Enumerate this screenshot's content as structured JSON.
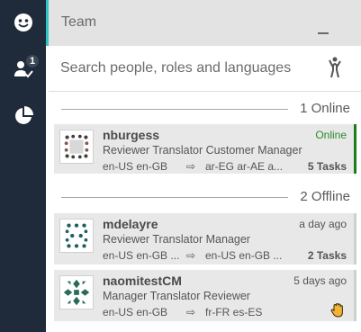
{
  "sidebar": {
    "items": [
      {
        "icon": "face-icon",
        "active": true
      },
      {
        "icon": "person-check-icon",
        "badge": "1"
      },
      {
        "icon": "pie-chart-icon"
      }
    ]
  },
  "header": {
    "title": "Team"
  },
  "search": {
    "placeholder": "Search people, roles and languages"
  },
  "sections": {
    "online": {
      "label": "1 Online"
    },
    "offline": {
      "label": "2 Offline"
    }
  },
  "users": [
    {
      "name": "nburgess",
      "status": "Online",
      "roles": "Reviewer Translator Customer Manager",
      "source_langs": "en-US en-GB",
      "target_langs": "ar-EG ar-AE a...",
      "tasks": "5 Tasks"
    },
    {
      "name": "mdelayre",
      "status": "a day ago",
      "roles": "Reviewer Translator Manager",
      "source_langs": "en-US en-GB ...",
      "target_langs": "en-US en-GB ...",
      "tasks": "2 Tasks"
    },
    {
      "name": "naomitestCM",
      "status": "5 days ago",
      "roles": "Manager Translator Reviewer",
      "source_langs": "en-US en-GB",
      "target_langs": "fr-FR es-ES",
      "tasks_icon": "raised-hand-icon"
    }
  ],
  "arrow_glyph": "⇨",
  "colors": {
    "sidebar": "#1f2b3a",
    "accent": "#2ec4c4",
    "online": "#1b7d1b"
  }
}
